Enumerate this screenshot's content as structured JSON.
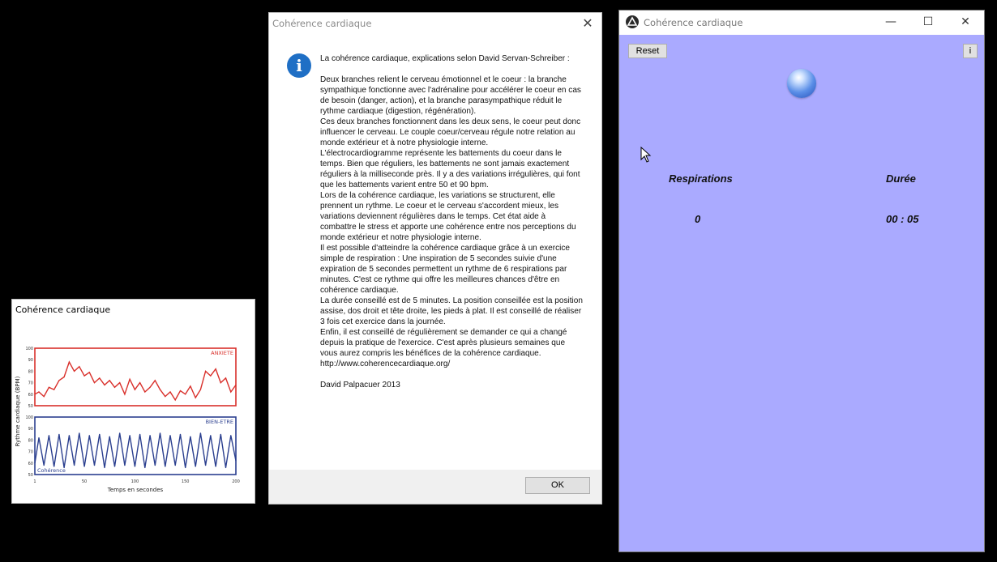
{
  "chart_window": {
    "title": "Cohérence cardiaque",
    "chart_data": [
      {
        "type": "line",
        "ylabel": "Rythme cardiaque (BPM)",
        "xlabel": "Temps en secondes",
        "x_ticks": [
          "1",
          "50",
          "100",
          "150",
          "200"
        ],
        "y_ticks": [
          "100",
          "90",
          "80",
          "70",
          "60",
          "50"
        ],
        "ylim": [
          50,
          100
        ],
        "series": [
          {
            "name": "ANXIETE",
            "color": "#d9302b",
            "x": [
              1,
              5,
              10,
              15,
              20,
              25,
              30,
              35,
              40,
              45,
              50,
              55,
              60,
              65,
              70,
              75,
              80,
              85,
              90,
              95,
              100,
              105,
              110,
              115,
              120,
              125,
              130,
              135,
              140,
              145,
              150,
              155,
              160,
              165,
              170,
              175,
              180,
              185,
              190,
              195,
              200
            ],
            "values": [
              60,
              62,
              58,
              66,
              64,
              72,
              75,
              88,
              80,
              84,
              76,
              79,
              70,
              74,
              68,
              72,
              66,
              70,
              60,
              73,
              64,
              70,
              62,
              66,
              72,
              64,
              58,
              62,
              55,
              63,
              60,
              67,
              57,
              64,
              80,
              76,
              82,
              70,
              74,
              62,
              68
            ]
          }
        ]
      },
      {
        "type": "line",
        "ylabel": "Rythme cardiaque (BPM)",
        "xlabel": "Temps en secondes",
        "x_ticks": [
          "1",
          "50",
          "100",
          "150",
          "200"
        ],
        "y_ticks": [
          "100",
          "90",
          "80",
          "70",
          "60",
          "50"
        ],
        "ylim": [
          50,
          100
        ],
        "series": [
          {
            "name": "BIEN-ETRE",
            "color": "#2b3f8f",
            "x": [
              1,
              5,
              10,
              15,
              20,
              25,
              30,
              35,
              40,
              45,
              50,
              55,
              60,
              65,
              70,
              75,
              80,
              85,
              90,
              95,
              100,
              105,
              110,
              115,
              120,
              125,
              130,
              135,
              140,
              145,
              150,
              155,
              160,
              165,
              170,
              175,
              180,
              185,
              190,
              195,
              200
            ],
            "values": [
              60,
              82,
              58,
              84,
              57,
              85,
              56,
              84,
              58,
              86,
              57,
              84,
              58,
              85,
              56,
              83,
              57,
              86,
              58,
              84,
              57,
              85,
              56,
              84,
              58,
              86,
              57,
              84,
              58,
              85,
              56,
              83,
              57,
              86,
              58,
              84,
              57,
              85,
              56,
              84,
              62
            ]
          }
        ],
        "annotation": "Cohérence"
      }
    ]
  },
  "dialog": {
    "title": "Cohérence cardiaque",
    "heading": "La cohérence cardiaque, explications selon David Servan-Schreiber :",
    "paragraphs": [
      "Deux branches relient le cerveau émotionnel et le coeur : la branche sympathique fonctionne avec l'adrénaline pour accélérer le coeur en cas de besoin (danger, action), et la branche parasympathique réduit le rythme cardiaque (digestion, régénération).",
      "Ces deux branches fonctionnent dans les deux sens, le coeur peut donc influencer le cerveau. Le couple coeur/cerveau régule notre relation au monde extérieur et à notre physiologie interne.",
      "L'électrocardiogramme représente les battements du coeur dans le temps. Bien que réguliers, les battements ne sont jamais exactement réguliers à la milliseconde près.  Il y a des variations irrégulières, qui font que les battements varient entre 50 et 90 bpm.",
      "Lors de la cohérence cardiaque, les variations se structurent, elle prennent un rythme. Le coeur et le cerveau s'accordent mieux, les variations deviennent régulières dans le temps. Cet état aide à combattre le stress et apporte une cohérence entre nos perceptions du monde extérieur et notre physiologie interne.",
      "Il est possible d'atteindre la cohérence cardiaque grâce à un exercice simple de respiration : Une inspiration de 5 secondes suivie d'une expiration de 5 secondes permettent un rythme de 6 respirations par minutes. C'est ce rythme qui offre les meilleures chances d'être en cohérence cardiaque.",
      "La durée conseillé est de 5 minutes. La position conseillée est la position assise, dos droit et tête droite, les pieds à plat. Il est conseillé de réaliser 3 fois cet exercice dans la journée.",
      "Enfin, il est conseillé de régulièrement se demander ce qui a changé depuis la pratique de l'exercice. C'est après plusieurs semaines que vous aurez compris les bénéfices de la cohérence cardiaque.",
      "http://www.coherencecardiaque.org/"
    ],
    "signature": "David Palpacuer 2013",
    "ok_label": "OK",
    "close_glyph": "✕",
    "icon_glyph": "i"
  },
  "app": {
    "title": "Cohérence cardiaque",
    "minimize_glyph": "—",
    "maximize_glyph": "☐",
    "close_glyph": "✕",
    "reset_label": "Reset",
    "info_label": "i",
    "respirations_label": "Respirations",
    "duree_label": "Durée",
    "respirations_value": "0",
    "duree_value": "00 : 05",
    "client_color": "#aaaaff"
  }
}
